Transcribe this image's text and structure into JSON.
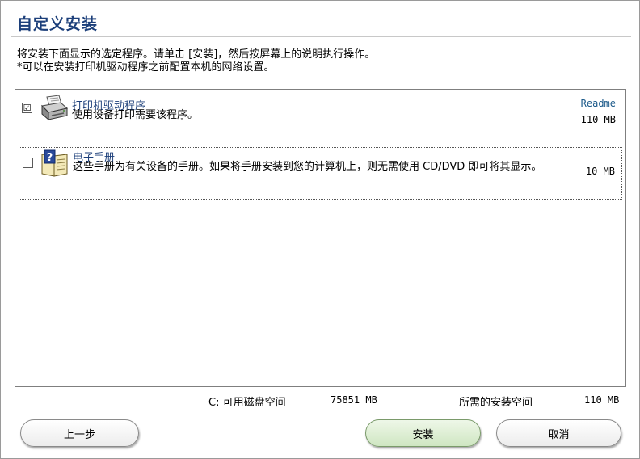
{
  "window": {
    "title": "自定义安装"
  },
  "instructions": {
    "line1": "将安装下面显示的选定程序。请单击 [安装]，然后按屏幕上的说明执行操作。",
    "line2": "*可以在安装打印机驱动程序之前配置本机的网络设置。"
  },
  "items": [
    {
      "name": "打印机驱动程序",
      "description": "使用设备打印需要该程序。",
      "checked": true,
      "check_glyph": "☑",
      "readme": "Readme",
      "size": "110 MB",
      "icon": "printer-icon"
    },
    {
      "name": "电子手册",
      "description": "这些手册为有关设备的手册。如果将手册安装到您的计算机上，则无需使用 CD/DVD 即可将其显示。",
      "checked": false,
      "check_glyph": "",
      "size": "10 MB",
      "icon": "manual-book-icon"
    }
  ],
  "disk": {
    "available_label": "C: 可用磁盘空间",
    "available_value": "75851 MB",
    "required_label": "所需的安装空间",
    "required_value": "110 MB"
  },
  "buttons": {
    "back": "上一步",
    "install": "安装",
    "cancel": "取消"
  },
  "colors": {
    "title": "#1c3f7a",
    "install_button": "#cfe6c2"
  }
}
